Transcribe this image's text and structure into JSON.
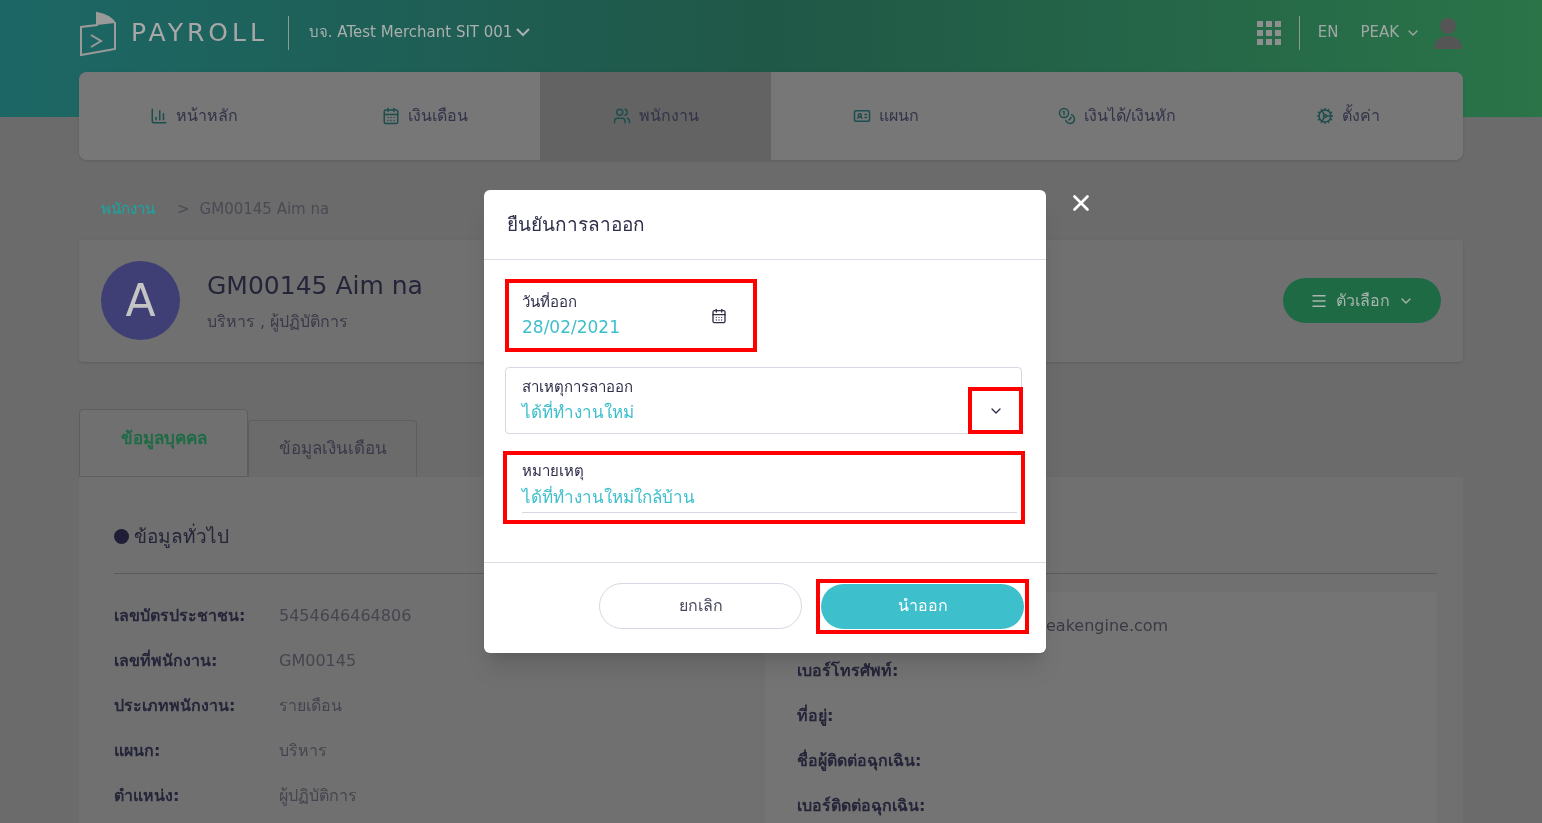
{
  "header": {
    "logo_text": "PAYROLL",
    "company": "บจ. ATest Merchant SIT 001",
    "language": "EN",
    "user": "PEAK"
  },
  "nav": [
    {
      "label": "หน้าหลัก",
      "selected": false
    },
    {
      "label": "เงินเดือน",
      "selected": false
    },
    {
      "label": "พนักงาน",
      "selected": true
    },
    {
      "label": "แผนก",
      "selected": false
    },
    {
      "label": "เงินได้/เงินหัก",
      "selected": false
    },
    {
      "label": "ตั้งค่า",
      "selected": false
    }
  ],
  "breadcrumb": {
    "parent": "พนักงาน",
    "separator": ">",
    "current": "GM00145 Aim na"
  },
  "profile": {
    "initial": "A",
    "name": "GM00145 Aim na",
    "subtitle": "บริหาร , ผู้ปฏิบัติการ",
    "options_button": "ตัวเลือก"
  },
  "tabs": [
    {
      "label": "ข้อมูลบุคคล",
      "selected": true
    },
    {
      "label": "ข้อมูลเงินเดือน",
      "selected": false
    }
  ],
  "general": {
    "title": "ข้อมูลทั่วไป",
    "rows": [
      {
        "label": "เลขบัตรประชาชน:",
        "value": "5454646464806"
      },
      {
        "label": "เลขที่พนักงาน:",
        "value": "GM00145"
      },
      {
        "label": "ประเภทพนักงาน:",
        "value": "รายเดือน"
      },
      {
        "label": "แผนก:",
        "value": "บริหาร"
      },
      {
        "label": "ตำแหน่ง:",
        "value": "ผู้ปฏิบัติการ"
      }
    ]
  },
  "contact": {
    "email_fragment": "eakengine.com",
    "labels": [
      "เบอร์โทรศัพท์:",
      "ที่อยู่:",
      "ชื่อผู้ติดต่อฉุกเฉิน:",
      "เบอร์ติดต่อฉุกเฉิน:"
    ]
  },
  "dialog": {
    "title": "ยืนยันการลาออก",
    "fields": [
      {
        "kind": "date",
        "label": "วันที่ออก",
        "value": "28/02/2021",
        "highlighted": true
      },
      {
        "kind": "select",
        "label": "สาเหตุการลาออก",
        "value": "ได้ที่ทำงานใหม่",
        "highlighted": true
      },
      {
        "kind": "text",
        "label": "หมายเหตุ",
        "value": "ได้ที่ทำงานใหม่ใกล้บ้าน",
        "highlighted": true
      }
    ],
    "cancel_button": {
      "label": "ยกเลิก",
      "highlighted": false
    },
    "confirm_button": {
      "label": "นำออก",
      "highlighted": true
    }
  }
}
